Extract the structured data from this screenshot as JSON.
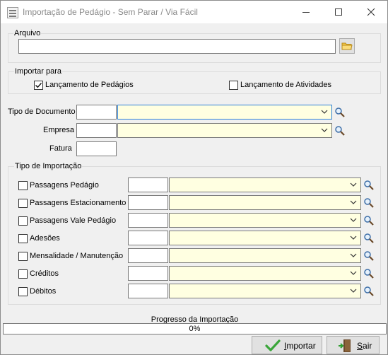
{
  "window": {
    "title": "Importação de Pedágio - Sem Parar /  Via Fácil"
  },
  "arquivo": {
    "legend": "Arquivo",
    "path_value": ""
  },
  "importar_para": {
    "legend": "Importar para",
    "options": [
      {
        "label": "Lançamento de Pedágios",
        "checked": true
      },
      {
        "label": "Lançamento de Atividades",
        "checked": false
      }
    ]
  },
  "form": {
    "tipo_documento": {
      "label": "Tipo de Documento",
      "code": "",
      "description": ""
    },
    "empresa": {
      "label": "Empresa",
      "code": "",
      "description": ""
    },
    "fatura": {
      "label": "Fatura",
      "value": ""
    }
  },
  "tipo_importacao": {
    "legend": "Tipo de Importação",
    "rows": [
      {
        "label": "Passagens Pedágio",
        "checked": false,
        "code": "",
        "description": ""
      },
      {
        "label": "Passagens Estacionamento",
        "checked": false,
        "code": "",
        "description": ""
      },
      {
        "label": "Passagens Vale Pedágio",
        "checked": false,
        "code": "",
        "description": ""
      },
      {
        "label": "Adesões",
        "checked": false,
        "code": "",
        "description": ""
      },
      {
        "label": "Mensalidade / Manutenção",
        "checked": false,
        "code": "",
        "description": ""
      },
      {
        "label": "Créditos",
        "checked": false,
        "code": "",
        "description": ""
      },
      {
        "label": "Débitos",
        "checked": false,
        "code": "",
        "description": ""
      }
    ]
  },
  "progress": {
    "label": "Progresso da Importação",
    "text": "0%",
    "percent": 0
  },
  "buttons": {
    "importar": {
      "underlined": "I",
      "rest": "mportar"
    },
    "sair": {
      "underlined": "S",
      "rest": "air"
    }
  },
  "colors": {
    "combo_bg": "#ffffe1",
    "progress_fill": "#06b025",
    "focus_border": "#2c7fd6"
  }
}
